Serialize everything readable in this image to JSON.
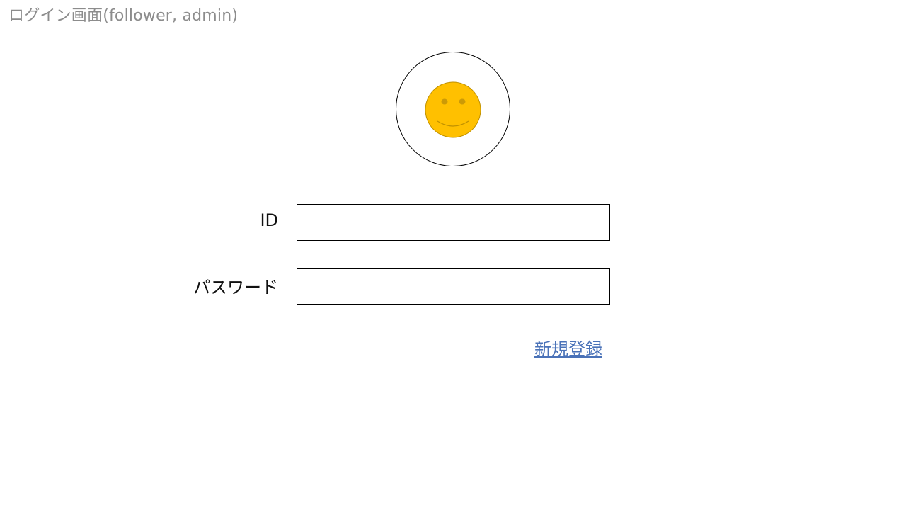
{
  "page": {
    "title": "ログイン画面(follower, admin)"
  },
  "avatar": {
    "icon": "smiley-face-icon",
    "face_color": "#FFC000",
    "outline_color": "#BF9000"
  },
  "login_form": {
    "id_label": "ID",
    "id_value": "",
    "password_label": "パスワード",
    "password_value": ""
  },
  "links": {
    "register_label": "新規登録",
    "register_color": "#4A72B8"
  }
}
